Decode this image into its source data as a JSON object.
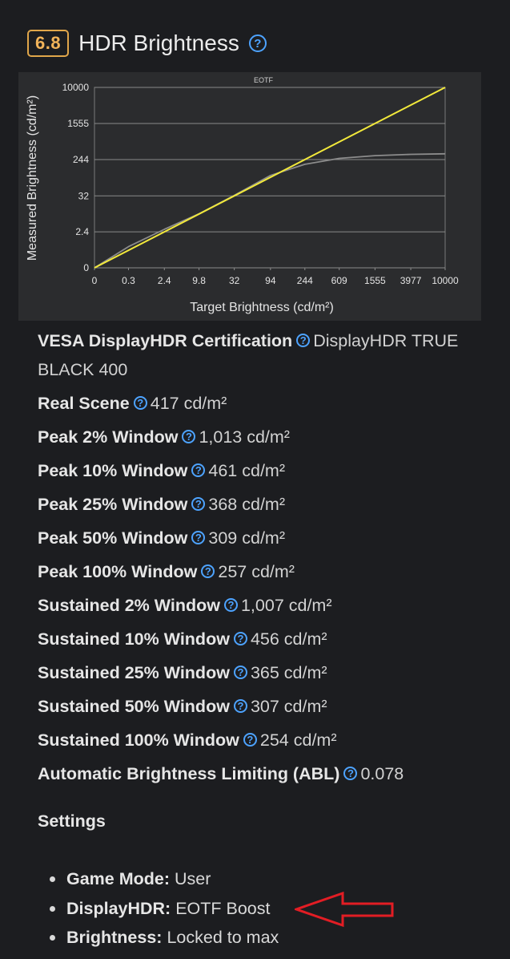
{
  "section": {
    "score": "6.8",
    "title": "HDR Brightness",
    "help_icon": "question-circle-icon"
  },
  "chart_data": {
    "type": "line",
    "title": "EOTF",
    "xlabel": "Target Brightness (cd/m²)",
    "ylabel": "Measured Brightness (cd/m²)",
    "x_scale": "pq",
    "y_scale": "pq",
    "x_ticks": [
      "0",
      "0.3",
      "2.4",
      "9.8",
      "32",
      "94",
      "244",
      "609",
      "1555",
      "3977",
      "10000"
    ],
    "y_ticks": [
      "0",
      "2.4",
      "32",
      "244",
      "1555",
      "10000"
    ],
    "grid": true,
    "series": [
      {
        "name": "",
        "color": "#f2e93b",
        "x": [
          0,
          10000
        ],
        "y": [
          0,
          10000
        ]
      },
      {
        "name": "",
        "color": "#8c8c8c",
        "x": [
          0,
          0.3,
          2.4,
          9.8,
          32,
          94,
          244,
          609,
          1555,
          3977,
          10000
        ],
        "y": [
          0,
          0.5,
          3,
          10,
          33,
          104,
          190,
          260,
          300,
          320,
          330
        ]
      }
    ]
  },
  "metrics": [
    {
      "label": "VESA DisplayHDR Certification",
      "value": "DisplayHDR TRUE BLACK 400"
    },
    {
      "label": "Real Scene",
      "value": "417 cd/m²"
    },
    {
      "label": "Peak 2% Window",
      "value": "1,013 cd/m²"
    },
    {
      "label": "Peak 10% Window",
      "value": "461 cd/m²"
    },
    {
      "label": "Peak 25% Window",
      "value": "368 cd/m²"
    },
    {
      "label": "Peak 50% Window",
      "value": "309 cd/m²"
    },
    {
      "label": "Peak 100% Window",
      "value": "257 cd/m²"
    },
    {
      "label": "Sustained 2% Window",
      "value": "1,007 cd/m²"
    },
    {
      "label": "Sustained 10% Window",
      "value": "456 cd/m²"
    },
    {
      "label": "Sustained 25% Window",
      "value": "365 cd/m²"
    },
    {
      "label": "Sustained 50% Window",
      "value": "307 cd/m²"
    },
    {
      "label": "Sustained 100% Window",
      "value": "254 cd/m²"
    },
    {
      "label": "Automatic Brightness Limiting (ABL)",
      "value": "0.078"
    }
  ],
  "settings": {
    "heading": "Settings",
    "items": [
      {
        "label": "Game Mode:",
        "value": "User"
      },
      {
        "label": "DisplayHDR:",
        "value": "EOTF Boost"
      },
      {
        "label": "Brightness:",
        "value": "Locked to max"
      }
    ]
  },
  "colors": {
    "score_badge": "#e0a64a",
    "help_icon": "#4da3ff",
    "annotation_arrow": "#e21d24"
  }
}
